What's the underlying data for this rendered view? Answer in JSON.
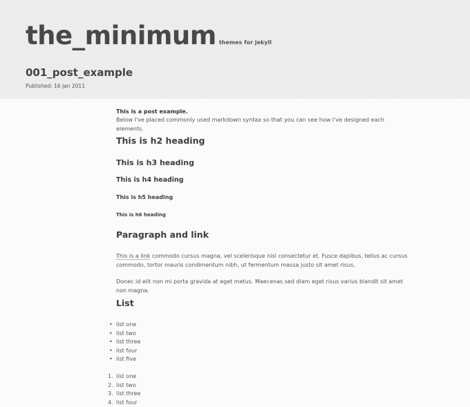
{
  "header": {
    "site_title": "the_minimum",
    "tagline": "themes for jekyll",
    "post_title": "001_post_example",
    "published": "Published: 16 Jan 2011"
  },
  "content": {
    "intro_bold": "This is a post example.",
    "intro_text": "Below I've placed commonly used markdown syntax so that you can see how I've designed each elements.",
    "h2": "This is h2 heading",
    "h3": "This is h3 heading",
    "h4": "This is h4 heading",
    "h5": "This is h5 heading",
    "h6": "This is h6 heading",
    "paragraph_heading": "Paragraph and link",
    "para1_link": "This is a link",
    "para1_text": " commodo cursus magna, vel scelerisque nisl consectetur et. Fusce dapibus, tellus ac cursus commodo, tortor mauris condimentum nibh, ut fermentum massa justo sit amet risus.",
    "para2": "Donec id elit non mi porta gravida at eget metus. Maecenas sed diam eget risus varius blandit sit amet non magna.",
    "list_heading": "List",
    "unordered": [
      "list one",
      "list two",
      "list three",
      "list four",
      "list five"
    ],
    "ordered": [
      "list one",
      "list two",
      "list three",
      "list four"
    ],
    "ordered_markers": [
      "1.",
      "2.",
      "3.",
      "4."
    ]
  }
}
